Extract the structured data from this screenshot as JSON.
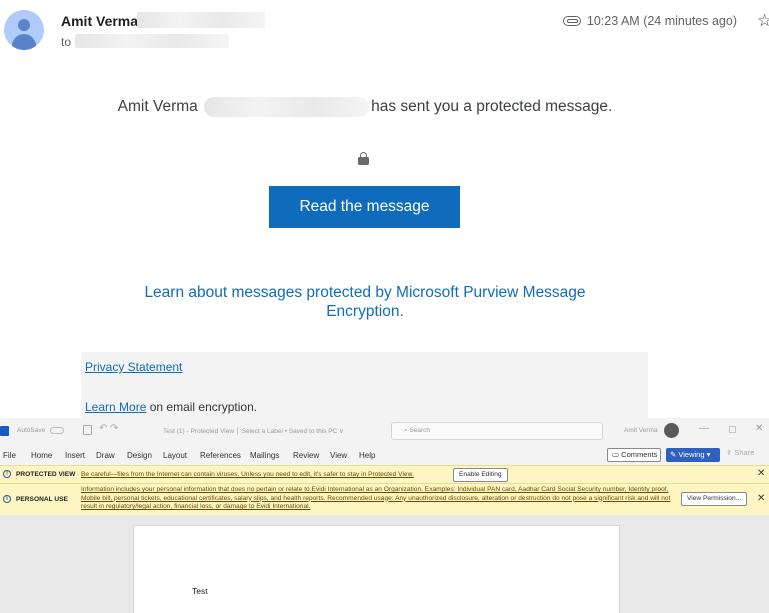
{
  "email": {
    "sender_name": "Amit Verma",
    "to_prefix": "to r",
    "time": "10:23 AM (24 minutes ago)",
    "protected_prefix": "Amit Verma",
    "protected_suffix": "has sent you a protected message.",
    "read_button": "Read the message",
    "learn_link": "Learn about messages protected by Microsoft Purview Message Encryption.",
    "privacy_link": "Privacy Statement",
    "learn_more_link": "Learn More",
    "learn_more_suffix": "on email encryption."
  },
  "word": {
    "autosave": "AutoSave",
    "title": "Test (1) - Protected View  │ Select a Label • Saved to this PC ∨",
    "search_placeholder": "Search",
    "user": "Amit Verma",
    "menu": [
      "File",
      "Home",
      "Insert",
      "Draw",
      "Design",
      "Layout",
      "References",
      "Mailings",
      "Review",
      "View",
      "Help"
    ],
    "comments": "Comments",
    "viewing": "Viewing",
    "share": "Share",
    "protected_view": {
      "title": "PROTECTED VIEW",
      "message": "Be careful—files from the Internet can contain viruses. Unless you need to edit, it's safer to stay in Protected View.",
      "button": "Enable Editing"
    },
    "personal_use": {
      "title": "PERSONAL USE",
      "message": "Information includes your personal information that does no pertain or relate to Evidi International as an Organization. Examples: Individual PAN card, Aadhar Card Social Security number, Identity proof, Mobile bill, personal tickets, educational certificates, salary slips, and health reports. Recommended usage: Any unauthorized disclosure, alteration or destruction do not pose a significant risk and will not result in regulatory/legal action, financial loss, or damage to Evidi International.",
      "button": "View Permission..."
    },
    "doc_text": "Test"
  }
}
